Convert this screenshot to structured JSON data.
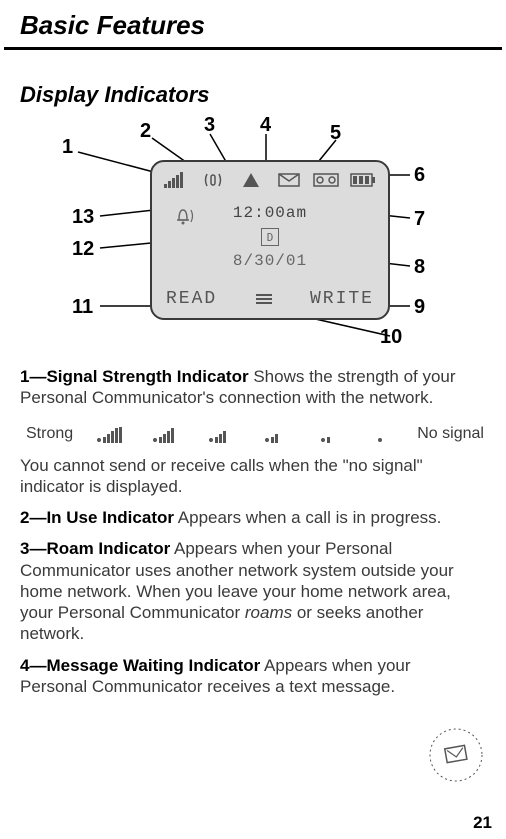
{
  "chapter_title": "Basic Features",
  "section_title": "Display Indicators",
  "screen": {
    "time": "12:00am",
    "date": "8/30/01",
    "d_label": "D",
    "soft_left": "READ",
    "soft_right": "WRITE"
  },
  "callouts": {
    "c1": "1",
    "c2": "2",
    "c3": "3",
    "c4": "4",
    "c5": "5",
    "c6": "6",
    "c7": "7",
    "c8": "8",
    "c9": "9",
    "c10": "10",
    "c11": "11",
    "c12": "12",
    "c13": "13"
  },
  "legend": {
    "item1_lead": "1—Signal Strength Indicator",
    "item1_text": "  Shows the strength of your Personal Communicator's connection with the network.",
    "strong": "Strong",
    "nosig": "No signal",
    "nosig_after": "You cannot send or receive calls when the \"no signal\" indicator is displayed.",
    "item2_lead": "2—In Use Indicator",
    "item2_text": "  Appears when a call is in progress.",
    "item3_lead": "3—Roam Indicator",
    "item3_text": "  Appears when your Personal Communicator uses another network system outside your home network. When you leave your home network area, your Personal Communicator ",
    "item3_roams": "roams",
    "item3_tail": " or seeks another network.",
    "item4_lead": "4—Message Waiting Indicator",
    "item4_text": "  Appears when your Personal Communicator receives a text message."
  },
  "page_number": "21"
}
